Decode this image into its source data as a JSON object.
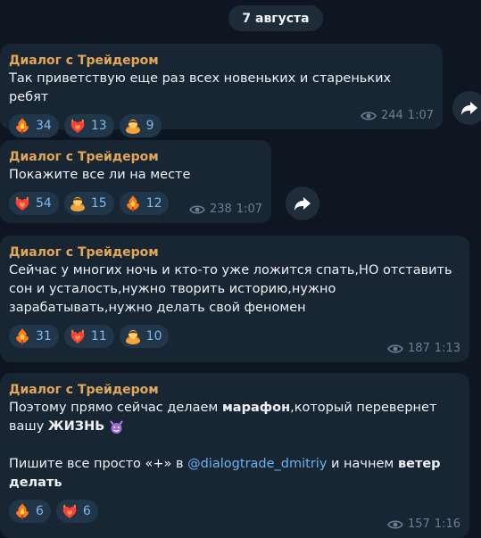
{
  "date_label": "7 августа",
  "messages": [
    {
      "sender": "Диалог с Трейдером",
      "text": "Так приветствую еще раз всех новеньких и стареньких ребят",
      "reactions": [
        {
          "emoji": "fire-flower",
          "count": "34"
        },
        {
          "emoji": "heart-on-fire",
          "count": "13"
        },
        {
          "emoji": "bowing-man",
          "count": "9"
        }
      ],
      "views": "244",
      "time": "1:07"
    },
    {
      "sender": "Диалог с Трейдером",
      "text": "Покажите все ли на месте",
      "reactions": [
        {
          "emoji": "heart-on-fire",
          "count": "54"
        },
        {
          "emoji": "bowing-man",
          "count": "15"
        },
        {
          "emoji": "fire-flower",
          "count": "12"
        }
      ],
      "views": "238",
      "time": "1:07"
    },
    {
      "sender": "Диалог с Трейдером",
      "text": "Сейчас у многих ночь и кто-то уже ложится спать,НО отставить сон и усталость,нужно творить историю,нужно зарабатывать,нужно делать свой феномен",
      "reactions": [
        {
          "emoji": "fire-flower",
          "count": "31"
        },
        {
          "emoji": "heart-on-fire",
          "count": "11"
        },
        {
          "emoji": "bowing-man",
          "count": "10"
        }
      ],
      "views": "187",
      "time": "1:13"
    },
    {
      "sender": "Диалог с Трейдером",
      "text_part1": "Поэтому прямо сейчас делаем ",
      "text_bold1": "марафон",
      "text_part2": ",который перевернет вашу ",
      "text_bold2": "ЖИЗНЬ",
      "text_part3": "Пишите все просто «+» в ",
      "mention": "@dialogtrade_dmitriy",
      "text_part4": " и начнем ",
      "text_bold3": "ветер делать",
      "reactions": [
        {
          "emoji": "fire-flower",
          "count": "6"
        },
        {
          "emoji": "heart-on-fire",
          "count": "6"
        }
      ],
      "views": "157",
      "time": "1:16"
    }
  ],
  "icons": {
    "views": "eye-icon",
    "forward": "forward-arrow-icon",
    "devil": "smiling-devil-emoji"
  },
  "colors": {
    "background": "#0e1621",
    "bubble": "#182533",
    "sender": "#e3a857",
    "mention": "#6ab3f3",
    "reaction_bg": "#22364a",
    "reaction_text": "#7db8ee",
    "meta": "#6b7f92"
  }
}
